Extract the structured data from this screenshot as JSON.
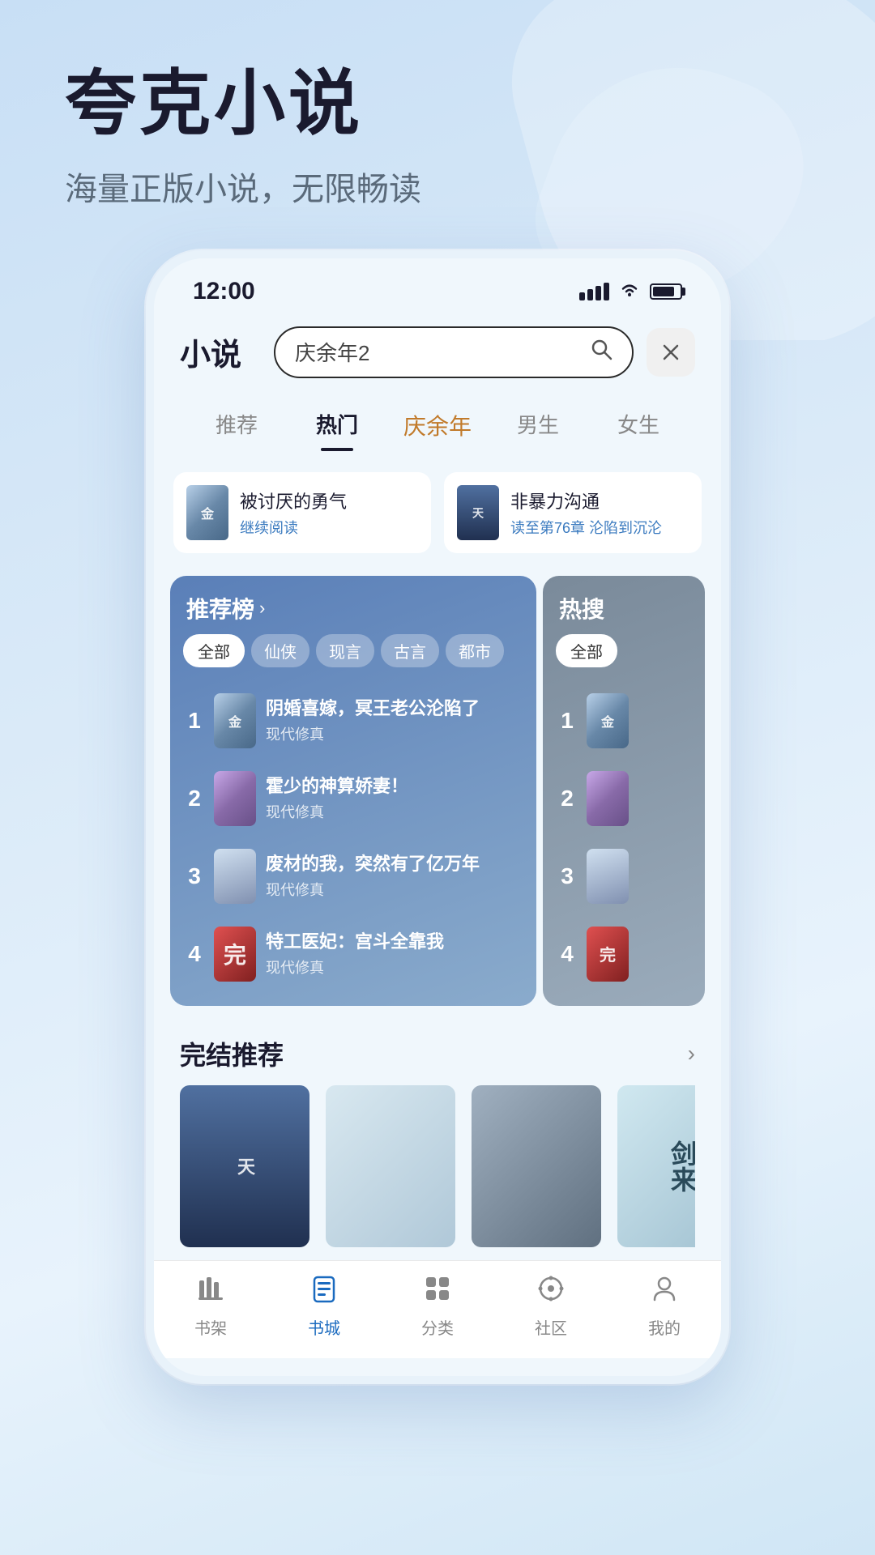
{
  "app": {
    "name": "夸克小说",
    "tagline": "海量正版小说，无限畅读"
  },
  "statusBar": {
    "time": "12:00"
  },
  "header": {
    "title": "小说",
    "searchPlaceholder": "庆余年2",
    "closeLabel": "×"
  },
  "navTabs": [
    {
      "label": "推荐",
      "active": false
    },
    {
      "label": "热门",
      "active": true
    },
    {
      "label": "庆余年",
      "special": true
    },
    {
      "label": "男生",
      "active": false
    },
    {
      "label": "女生",
      "active": false
    }
  ],
  "recentReads": [
    {
      "title": "被讨厌的勇气",
      "action": "继续阅读"
    },
    {
      "title": "非暴力沟通",
      "action": "读至第76章 沦陷到沉沦"
    }
  ],
  "rankingPanel": {
    "title": "推荐榜",
    "arrowLabel": "›",
    "filters": [
      "全部",
      "仙侠",
      "现言",
      "古言",
      "都市"
    ],
    "items": [
      {
        "rank": "1",
        "title": "阴婚喜嫁，冥王老公沦陷了",
        "tag": "现代修真"
      },
      {
        "rank": "2",
        "title": "霍少的神算娇妻！",
        "tag": "现代修真"
      },
      {
        "rank": "3",
        "title": "废材的我，突然有了亿万年",
        "tag": "现代修真"
      },
      {
        "rank": "4",
        "title": "特工医妃：宫斗全靠我",
        "tag": "现代修真"
      }
    ]
  },
  "hotSearchPanel": {
    "title": "热搜",
    "filters": [
      "全部"
    ],
    "items": [
      {
        "rank": "1"
      },
      {
        "rank": "2"
      },
      {
        "rank": "3"
      },
      {
        "rank": "4"
      }
    ]
  },
  "completedSection": {
    "title": "完结推荐",
    "arrowLabel": "›",
    "books": [
      {
        "title": "天"
      },
      {
        "title": ""
      },
      {
        "title": ""
      },
      {
        "title": "剑来"
      }
    ]
  },
  "bottomNav": [
    {
      "label": "书架",
      "icon": "bookshelf",
      "active": false
    },
    {
      "label": "书城",
      "icon": "book",
      "active": true
    },
    {
      "label": "分类",
      "icon": "grid",
      "active": false
    },
    {
      "label": "社区",
      "icon": "community",
      "active": false
    },
    {
      "label": "我的",
      "icon": "profile",
      "active": false
    }
  ]
}
